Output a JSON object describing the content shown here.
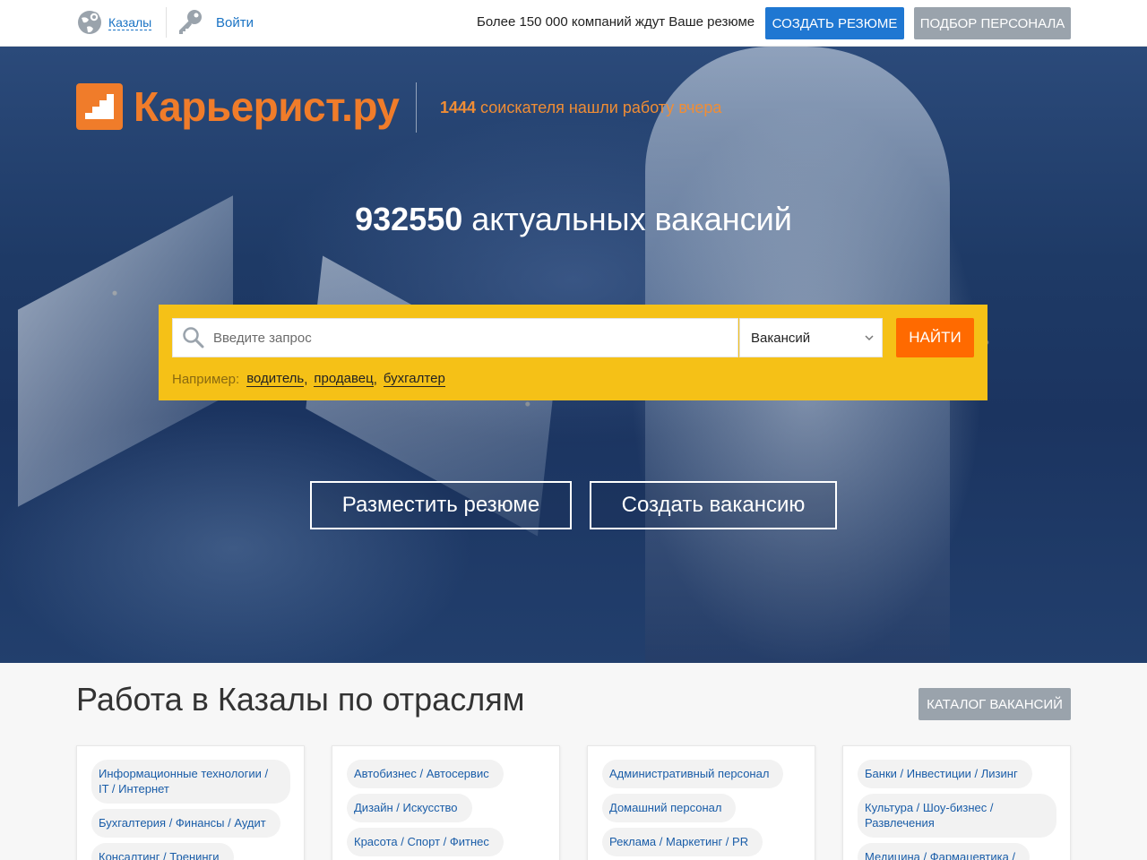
{
  "topbar": {
    "city": "Казалы",
    "login": "Войти",
    "promo": "Более 150 000 компаний ждут Ваше резюме",
    "create_resume": "Создать резюме",
    "hire_staff": "Подбор персонала"
  },
  "hero": {
    "logo_text": "Карьерист.ру",
    "tagline_count": "1444",
    "tagline_text": " соискателя нашли работу вчера",
    "vacancy_count": "932550",
    "vacancy_text": " актуальных вакансий"
  },
  "search": {
    "placeholder": "Введите запрос",
    "type_selected": "Вакансий",
    "submit": "Найти",
    "examples_label": "Например:",
    "examples": [
      "водитель",
      "продавец",
      "бухгалтер"
    ]
  },
  "actions": {
    "post_resume": "Разместить резюме",
    "create_vacancy": "Создать вакансию"
  },
  "industries": {
    "title": "Работа в Казалы по отраслям",
    "catalog_button": "Каталог вакансий",
    "columns": [
      [
        "Информационные технологии / IT / Интернет",
        "Бухгалтерия / Финансы / Аудит",
        "Консалтинг / Тренинги"
      ],
      [
        "Автобизнес / Автосервис",
        "Дизайн / Искусство",
        "Красота / Спорт / Фитнес"
      ],
      [
        "Административный персонал",
        "Домашний персонал",
        "Реклама / Маркетинг / PR"
      ],
      [
        "Банки / Инвестиции / Лизинг",
        "Культура / Шоу-бизнес / Развлечения",
        "Медицина / Фармацевтика /"
      ]
    ]
  },
  "colors": {
    "brand_orange": "#f07c2a",
    "search_yellow": "#f5c117",
    "find_orange": "#ff6a00",
    "primary_blue": "#1f77d2",
    "neutral_grey": "#9aa3ac"
  },
  "icons": [
    "globe-icon",
    "key-icon",
    "logo-stairs-icon",
    "search-icon",
    "chevron-down-icon"
  ]
}
